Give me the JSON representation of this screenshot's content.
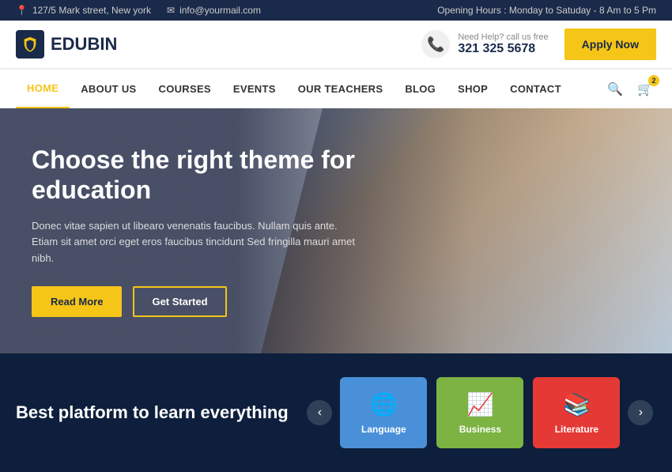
{
  "topbar": {
    "address": "127/5 Mark street, New york",
    "email": "info@yourmail.com",
    "opening_hours": "Opening Hours : Monday to Satuday - 8 Am to 5 Pm",
    "address_icon": "📍",
    "email_icon": "✉"
  },
  "header": {
    "logo_text": "EDUBIN",
    "help_text": "Need Help? call us free",
    "phone": "321 325 5678",
    "apply_btn": "Apply Now"
  },
  "nav": {
    "items": [
      {
        "label": "HOME",
        "active": true
      },
      {
        "label": "ABOUT US",
        "active": false
      },
      {
        "label": "COURSES",
        "active": false
      },
      {
        "label": "EVENTS",
        "active": false
      },
      {
        "label": "OUR TEACHERS",
        "active": false
      },
      {
        "label": "BLOG",
        "active": false
      },
      {
        "label": "SHOP",
        "active": false
      },
      {
        "label": "CONTACT",
        "active": false
      }
    ],
    "cart_count": "2"
  },
  "hero": {
    "title": "Choose the right theme for education",
    "description": "Donec vitae sapien ut libearo venenatis faucibus. Nullam quis ante. Etiam sit amet orci eget eros faucibus tincidunt Sed fringilla mauri amet nibh.",
    "btn_read_more": "Read More",
    "btn_get_started": "Get Started"
  },
  "bottom": {
    "title": "Best platform to learn everything",
    "cards": [
      {
        "label": "Language",
        "color": "card-blue",
        "icon": "🌐"
      },
      {
        "label": "Business",
        "color": "card-green",
        "icon": "📈"
      },
      {
        "label": "Literature",
        "color": "card-red",
        "icon": "📚"
      }
    ],
    "prev_arrow": "‹",
    "next_arrow": "›"
  }
}
